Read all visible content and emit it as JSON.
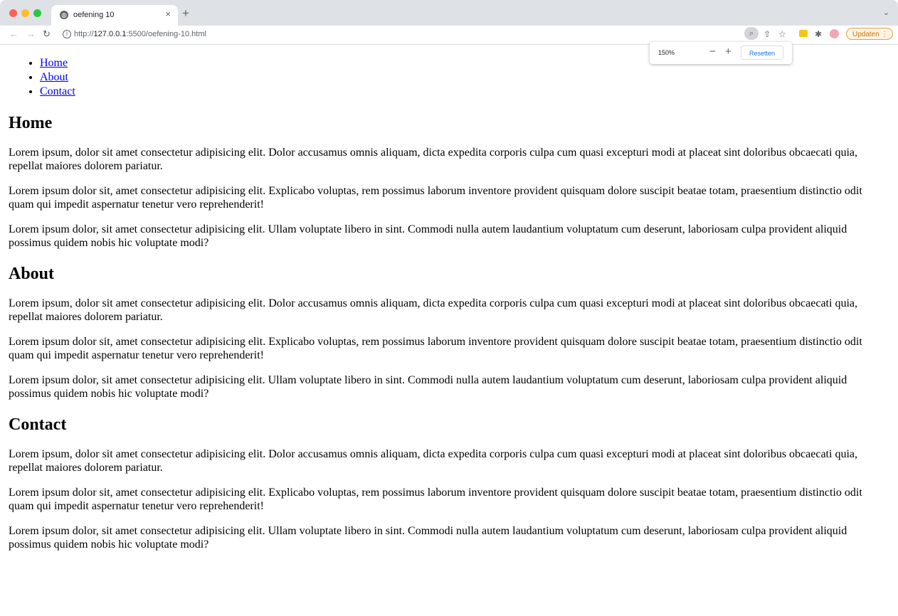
{
  "browser": {
    "tab_title": "oefening 10",
    "tab_close": "×",
    "new_tab": "+",
    "tab_menu": "⌄",
    "url_prefix": "http://",
    "url_host": "127.0.0.1",
    "url_rest": ":5500/oefening-10.html",
    "update_label": "Updaten",
    "update_menu": "⋮",
    "zoom_level": "150%",
    "zoom_minus": "−",
    "zoom_plus": "+",
    "zoom_reset_label": "Resetten"
  },
  "nav": {
    "items": [
      {
        "label": "Home"
      },
      {
        "label": "About"
      },
      {
        "label": "Contact"
      }
    ]
  },
  "sections": [
    {
      "heading": "Home",
      "paragraphs": [
        "Lorem ipsum, dolor sit amet consectetur adipisicing elit. Dolor accusamus omnis aliquam, dicta expedita corporis culpa cum quasi excepturi modi at placeat sint doloribus obcaecati quia, repellat maiores dolorem pariatur.",
        "Lorem ipsum dolor sit, amet consectetur adipisicing elit. Explicabo voluptas, rem possimus laborum inventore provident quisquam dolore suscipit beatae totam, praesentium distinctio odit quam qui impedit aspernatur tenetur vero reprehenderit!",
        "Lorem ipsum dolor, sit amet consectetur adipisicing elit. Ullam voluptate libero in sint. Commodi nulla autem laudantium voluptatum cum deserunt, laboriosam culpa provident aliquid possimus quidem nobis hic voluptate modi?"
      ]
    },
    {
      "heading": "About",
      "paragraphs": [
        "Lorem ipsum, dolor sit amet consectetur adipisicing elit. Dolor accusamus omnis aliquam, dicta expedita corporis culpa cum quasi excepturi modi at placeat sint doloribus obcaecati quia, repellat maiores dolorem pariatur.",
        "Lorem ipsum dolor sit, amet consectetur adipisicing elit. Explicabo voluptas, rem possimus laborum inventore provident quisquam dolore suscipit beatae totam, praesentium distinctio odit quam qui impedit aspernatur tenetur vero reprehenderit!",
        "Lorem ipsum dolor, sit amet consectetur adipisicing elit. Ullam voluptate libero in sint. Commodi nulla autem laudantium voluptatum cum deserunt, laboriosam culpa provident aliquid possimus quidem nobis hic voluptate modi?"
      ]
    },
    {
      "heading": "Contact",
      "paragraphs": [
        "Lorem ipsum, dolor sit amet consectetur adipisicing elit. Dolor accusamus omnis aliquam, dicta expedita corporis culpa cum quasi excepturi modi at placeat sint doloribus obcaecati quia, repellat maiores dolorem pariatur.",
        "Lorem ipsum dolor sit, amet consectetur adipisicing elit. Explicabo voluptas, rem possimus laborum inventore provident quisquam dolore suscipit beatae totam, praesentium distinctio odit quam qui impedit aspernatur tenetur vero reprehenderit!",
        "Lorem ipsum dolor, sit amet consectetur adipisicing elit. Ullam voluptate libero in sint. Commodi nulla autem laudantium voluptatum cum deserunt, laboriosam culpa provident aliquid possimus quidem nobis hic voluptate modi?"
      ]
    }
  ]
}
